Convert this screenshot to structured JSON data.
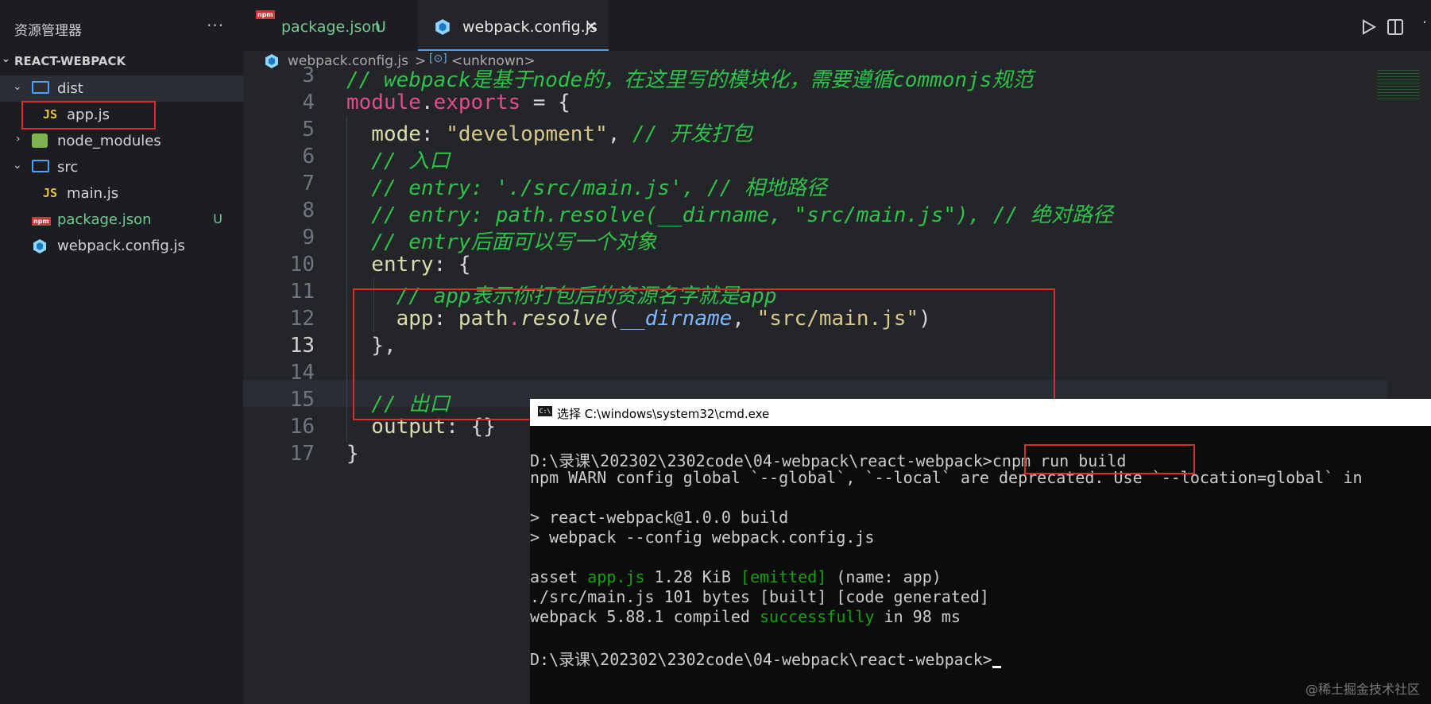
{
  "sidebar": {
    "title": "资源管理器",
    "more": "···",
    "project": "REACT-WEBPACK",
    "items": [
      {
        "label": "dist"
      },
      {
        "label": "app.js"
      },
      {
        "label": "node_modules"
      },
      {
        "label": "src"
      },
      {
        "label": "main.js"
      },
      {
        "label": "package.json",
        "badge": "U"
      },
      {
        "label": "webpack.config.js"
      }
    ],
    "npm_icon_text": "npm",
    "js_icon_text": "JS"
  },
  "tabs": [
    {
      "label": "package.json",
      "badge": "U"
    },
    {
      "label": "webpack.config.js",
      "close": "✕"
    }
  ],
  "breadcrumb": {
    "file": "webpack.config.js",
    "sep": ">",
    "symbol": "<unknown>"
  },
  "editor": {
    "line_numbers": [
      "3",
      "4",
      "5",
      "6",
      "7",
      "8",
      "9",
      "10",
      "11",
      "12",
      "13",
      "14",
      "15",
      "16",
      "17"
    ],
    "lines": {
      "l3": "// webpack是基于node的，在这里写的模块化，需要遵循commonjs规范",
      "l4a": "module",
      "l4b": ".",
      "l4c": "exports",
      "l4d": " = {",
      "l5a": "  mode",
      "l5b": ": ",
      "l5c": "\"development\"",
      "l5d": ", ",
      "l5e": "// 开发打包",
      "l6": "  // 入口",
      "l7": "  // entry: './src/main.js', // 相地路径",
      "l8": "  // entry: path.resolve(__dirname, \"src/main.js\"), // 绝对路径",
      "l9": "  // entry后面可以写一个对象",
      "l10a": "  entry",
      "l10b": ": {",
      "l11": "    // app表示你打包后的资源名字就是app",
      "l12a": "    app",
      "l12b": ": ",
      "l12c": "path",
      "l12d": ".",
      "l12e": "resolve",
      "l12f": "(",
      "l12g": "__dirname",
      "l12h": ", ",
      "l12i": "\"src/main.js\"",
      "l12j": ")",
      "l13": "  },",
      "l15": "  // 出口",
      "l16a": "  output",
      "l16b": ": {}",
      "l17": "}"
    }
  },
  "cmd": {
    "title": "选择 C:\\windows\\system32\\cmd.exe",
    "icon_text": "C:\\",
    "prompt1": "D:\\录课\\202302\\2302code\\04-webpack\\react-webpack>",
    "command": "cnpm run build",
    "warn": "npm WARN config global `--global`, `--local` are deprecated. Use `--location=global` in",
    "out1": "> react-webpack@1.0.0 build",
    "out2": "> webpack --config webpack.config.js",
    "asset_a": "asset ",
    "asset_b": "app.js",
    "asset_c": " 1.28 KiB ",
    "asset_d": "[emitted]",
    "asset_e": " (name: app)",
    "built": "./src/main.js 101 bytes [built] [code generated]",
    "compiled_a": "webpack 5.88.1 compiled ",
    "compiled_b": "successfully",
    "compiled_c": " in 98 ms",
    "prompt2": "D:\\录课\\202302\\2302code\\04-webpack\\react-webpack>"
  },
  "watermark": "@稀土掘金技术社区",
  "colors": {
    "accent": "#4aa3ff",
    "highlight_box": "#e02b2b",
    "comment": "#2ec24a",
    "keyword": "#e34c8e"
  }
}
